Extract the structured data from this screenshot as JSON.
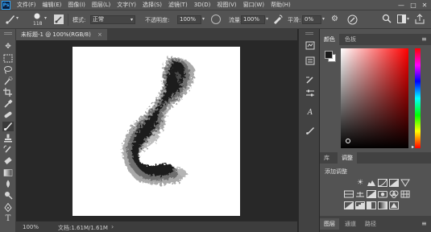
{
  "menu": {
    "logo": "Ps",
    "items": [
      "文件(F)",
      "编辑(E)",
      "图像(I)",
      "图层(L)",
      "文字(Y)",
      "选择(S)",
      "滤镜(T)",
      "3D(D)",
      "视图(V)",
      "窗口(W)",
      "帮助(H)"
    ],
    "window_controls": [
      "—",
      "□",
      "✕"
    ]
  },
  "options": {
    "brush_size": "118",
    "mode_label": "模式:",
    "mode_value": "正常",
    "opacity_label": "不透明度:",
    "opacity_value": "100%",
    "flow_label": "流量:",
    "flow_value": "100%",
    "smoothing_label": "平滑:",
    "smoothing_value": "0%"
  },
  "document": {
    "tab_title": "未标题-1 @ 100%(RGB/8)",
    "tab_close": "×",
    "zoom": "100%",
    "doc_info": "文档:1.61M/1.61M",
    "arrow": "›"
  },
  "color_panel": {
    "tabs": [
      "颜色",
      "色板"
    ],
    "menu_icon": "≡"
  },
  "adjust_panel": {
    "tabs": [
      "库",
      "调整"
    ],
    "title": "添加调整"
  },
  "layers_panel": {
    "tabs": [
      "图层",
      "通道",
      "路径"
    ]
  },
  "colors": {
    "ui_dark": "#282828",
    "ui_mid": "#535353",
    "foreground": "#1a1a1a",
    "background": "#ffffff",
    "selected_hue": "#ff0000"
  }
}
